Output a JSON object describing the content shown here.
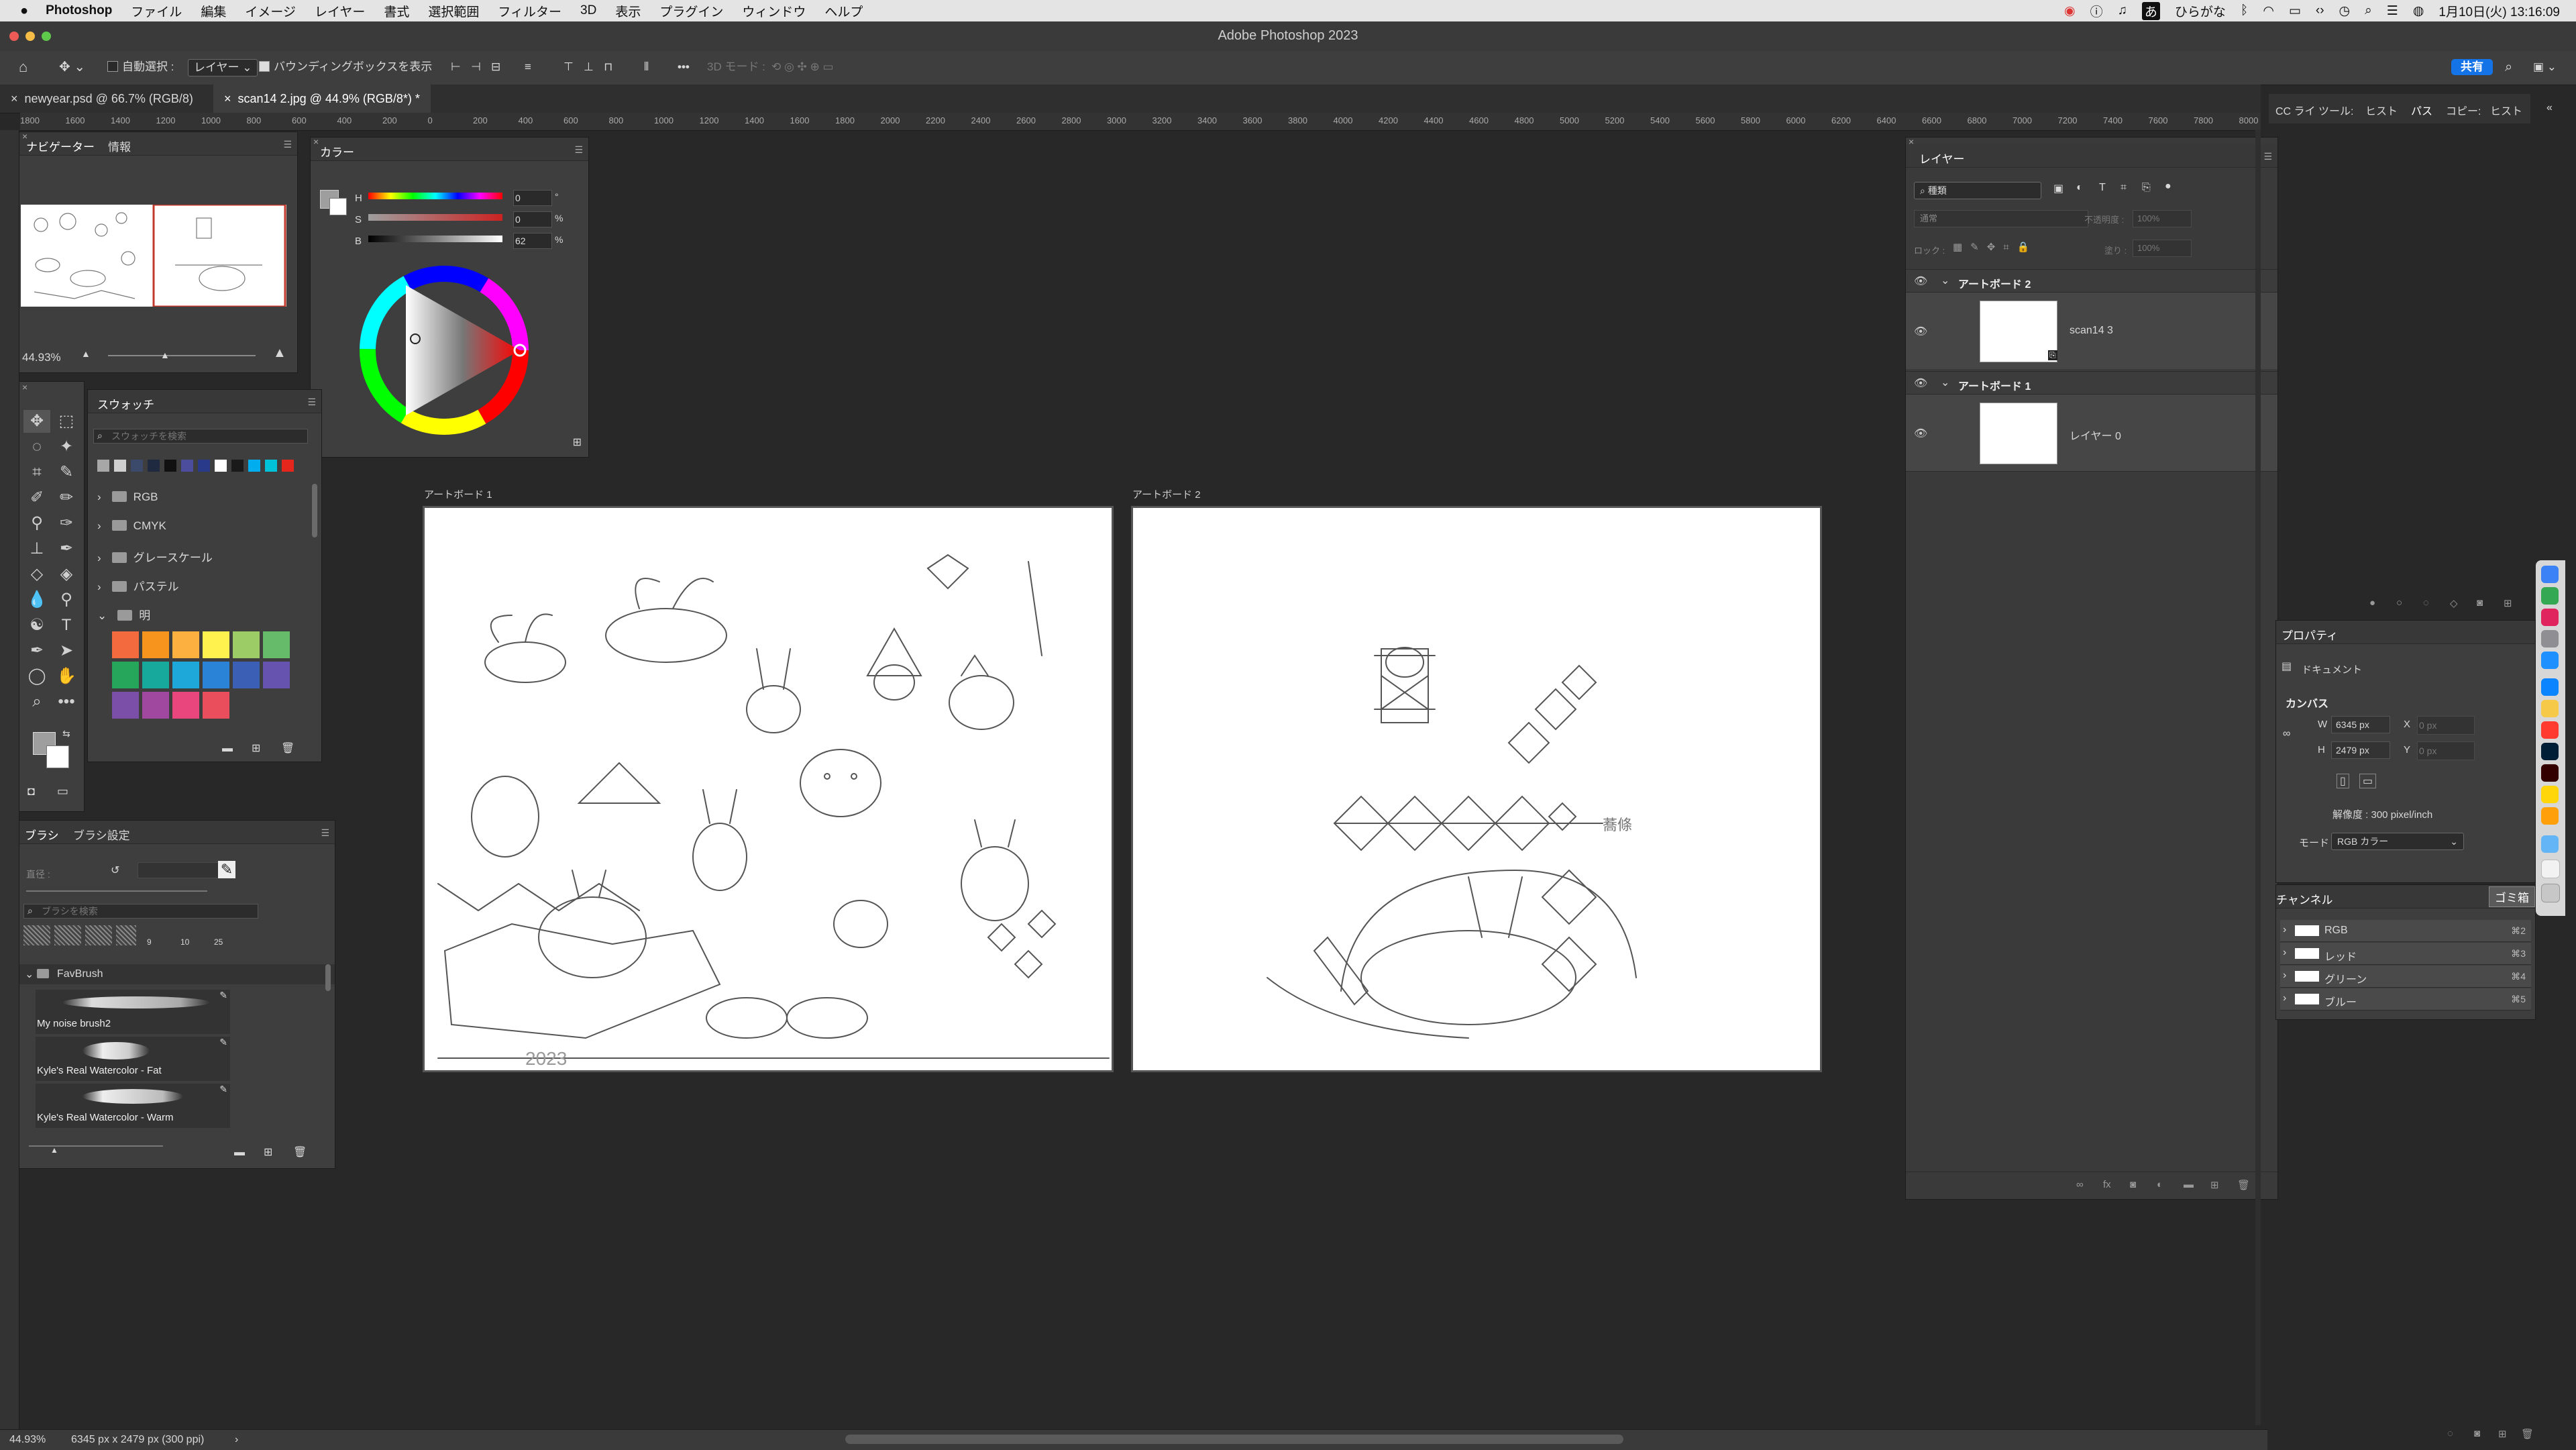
{
  "menubar": {
    "app": "Photoshop",
    "items": [
      "ファイル",
      "編集",
      "イメージ",
      "レイヤー",
      "書式",
      "選択範囲",
      "フィルター",
      "3D",
      "表示",
      "プラグイン",
      "ウィンドウ",
      "ヘルプ"
    ],
    "input_mode": "ひらがな",
    "input_glyph": "あ",
    "clock": "1月10日(火) 13:16:09"
  },
  "window": {
    "title": "Adobe Photoshop 2023"
  },
  "options": {
    "auto_select_label": "自動選択 :",
    "auto_select_value": "レイヤー",
    "bbox_label": "バウンディングボックスを表示",
    "mode_3d": "3D モード :",
    "share": "共有"
  },
  "tabs": [
    {
      "label": "newyear.psd @ 66.7% (RGB/8)"
    },
    {
      "label": "scan14 2.jpg @ 44.9% (RGB/8*) *"
    }
  ],
  "ruler": {
    "h_labels": [
      "1800",
      "1600",
      "1400",
      "1200",
      "1000",
      "800",
      "600",
      "400",
      "200",
      "0",
      "200",
      "400",
      "600",
      "800",
      "1000",
      "1200",
      "1400",
      "1600",
      "1800",
      "2000",
      "2200",
      "2400",
      "2600",
      "2800",
      "3000",
      "3200",
      "3400",
      "3600",
      "3800",
      "4000",
      "4200",
      "4400",
      "4600",
      "4800",
      "5000",
      "5200",
      "5400",
      "5600",
      "5800",
      "6000",
      "6200",
      "6400",
      "6600",
      "6800",
      "7000",
      "7200",
      "7400",
      "7600",
      "7800",
      "8000"
    ]
  },
  "navigator": {
    "tab1": "ナビゲーター",
    "tab2": "情報",
    "zoom": "44.93%"
  },
  "color": {
    "title": "カラー",
    "h_label": "H",
    "h_value": "0",
    "h_unit": "°",
    "s_label": "S",
    "s_value": "0",
    "s_unit": "%",
    "b_label": "B",
    "b_value": "62",
    "b_unit": "%"
  },
  "swatches": {
    "title": "スウォッチ",
    "search_placeholder": "スウォッチを検索",
    "recent": [
      "#a7a7a7",
      "#cfcfcf",
      "#3b4a6b",
      "#1f2a40",
      "#111111",
      "#4d4d9e",
      "#2a3a8a",
      "#ffffff",
      "#1a1a1a",
      "#00aeef",
      "#00c2d9",
      "#e4261d"
    ],
    "groups": [
      "RGB",
      "CMYK",
      "グレースケール",
      "パステル",
      "明"
    ],
    "bright": [
      "#f26a3d",
      "#f7941d",
      "#fbb040",
      "#fff24f",
      "#9ccc65",
      "#66bb6a",
      "#26a65b",
      "#17a99c",
      "#1ea7d9",
      "#2a83d6",
      "#3b5fb5",
      "#6653b0",
      "#7b4fa8",
      "#a0479f",
      "#e8467c",
      "#ea4d5c"
    ]
  },
  "brushes": {
    "tab1": "ブラシ",
    "tab2": "ブラシ設定",
    "size_label": "直径 :",
    "search_placeholder": "ブラシを検索",
    "preset_sizes": [
      "9",
      "10",
      "25"
    ],
    "group": "FavBrush",
    "items": [
      "My noise brush2",
      "Kyle's Real Watercolor - Fat",
      "Kyle's Real Watercolor - Warm"
    ]
  },
  "canvas": {
    "artboard1_label": "アートボード 1",
    "artboard2_label": "アートボード 2",
    "sketch_text1": "2023",
    "sketch_text2": "蕎條"
  },
  "layers": {
    "title": "レイヤー",
    "filter": "種類",
    "blend": "通常",
    "opacity_label": "不透明度 :",
    "opacity": "100%",
    "lock_label": "ロック :",
    "fill_label": "塗り :",
    "fill": "100%",
    "groups": [
      {
        "name": "アートボード 2",
        "layer": "scan14 3"
      },
      {
        "name": "アートボード 1",
        "layer": "レイヤー 0"
      }
    ]
  },
  "right_tabs": [
    "CC ライ",
    "ツール:",
    "ヒスト",
    "パス",
    "コピー:",
    "ヒスト"
  ],
  "properties": {
    "title": "プロパティ",
    "section": "ドキュメント",
    "canvas_label": "カンバス",
    "w_label": "W",
    "w_value": "6345 px",
    "x_label": "X",
    "x_placeholder": "0 px",
    "h_label": "H",
    "h_value": "2479 px",
    "y_label": "Y",
    "y_placeholder": "0 px",
    "resolution": "解像度 : 300 pixel/inch",
    "mode_label": "モード",
    "mode_value": "RGB カラー"
  },
  "channels": {
    "title": "チャンネル",
    "trash_tooltip": "ゴミ箱",
    "rows": [
      {
        "name": "RGB",
        "shortcut": "⌘2"
      },
      {
        "name": "レッド",
        "shortcut": "⌘3"
      },
      {
        "name": "グリーン",
        "shortcut": "⌘4"
      },
      {
        "name": "ブルー",
        "shortcut": "⌘5"
      }
    ]
  },
  "status": {
    "zoom": "44.93%",
    "doc_info": "6345 px x 2479 px (300 ppi)"
  }
}
